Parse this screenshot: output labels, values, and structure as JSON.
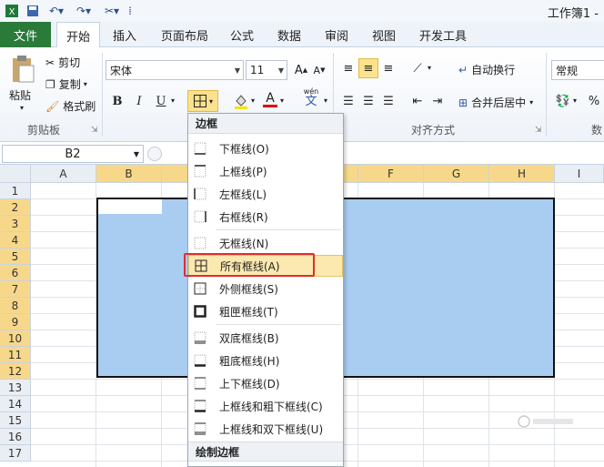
{
  "window": {
    "title": "工作簿1 -"
  },
  "qat": {
    "save_icon": "save-icon",
    "undo_icon": "undo-icon",
    "redo_icon": "redo-icon",
    "custom_icon": "tools-icon"
  },
  "tabs": [
    {
      "label": "文件"
    },
    {
      "label": "开始"
    },
    {
      "label": "插入"
    },
    {
      "label": "页面布局"
    },
    {
      "label": "公式"
    },
    {
      "label": "数据"
    },
    {
      "label": "审阅"
    },
    {
      "label": "视图"
    },
    {
      "label": "开发工具"
    }
  ],
  "ribbon": {
    "clipboard": {
      "paste": "粘贴",
      "cut": "剪切",
      "copy": "复制",
      "format_painter": "格式刷",
      "group": "剪贴板"
    },
    "font": {
      "name": "宋体",
      "size": "11",
      "bold": "B",
      "italic": "I",
      "underline": "U",
      "font_color_letter": "A",
      "phonetic": "wén"
    },
    "alignment": {
      "wrap": "自动换行",
      "merge": "合并后居中",
      "group": "对齐方式"
    },
    "number": {
      "format": "常规",
      "percent": "%",
      "group_partial": "数"
    }
  },
  "formula_bar": {
    "name_box": "B2"
  },
  "grid": {
    "columns": [
      "A",
      "B",
      "C",
      "D",
      "E",
      "F",
      "G",
      "H",
      "I"
    ],
    "rows": [
      "1",
      "2",
      "3",
      "4",
      "5",
      "6",
      "7",
      "8",
      "9",
      "10",
      "11",
      "12",
      "13",
      "14",
      "15",
      "16",
      "17"
    ]
  },
  "dropdown": {
    "header": "边框",
    "items": [
      {
        "label": "下框线(O)"
      },
      {
        "label": "上框线(P)"
      },
      {
        "label": "左框线(L)"
      },
      {
        "label": "右框线(R)"
      },
      {
        "label": "无框线(N)"
      },
      {
        "label": "所有框线(A)"
      },
      {
        "label": "外侧框线(S)"
      },
      {
        "label": "粗匣框线(T)"
      },
      {
        "label": "双底框线(B)"
      },
      {
        "label": "粗底框线(H)"
      },
      {
        "label": "上下框线(D)"
      },
      {
        "label": "上框线和粗下框线(C)"
      },
      {
        "label": "上框线和双下框线(U)"
      }
    ],
    "footer": "绘制边框"
  },
  "colors": {
    "file_tab": "#2a7a3a",
    "selection": "#a9cdf1",
    "highlight_box": "#e02d2d"
  }
}
